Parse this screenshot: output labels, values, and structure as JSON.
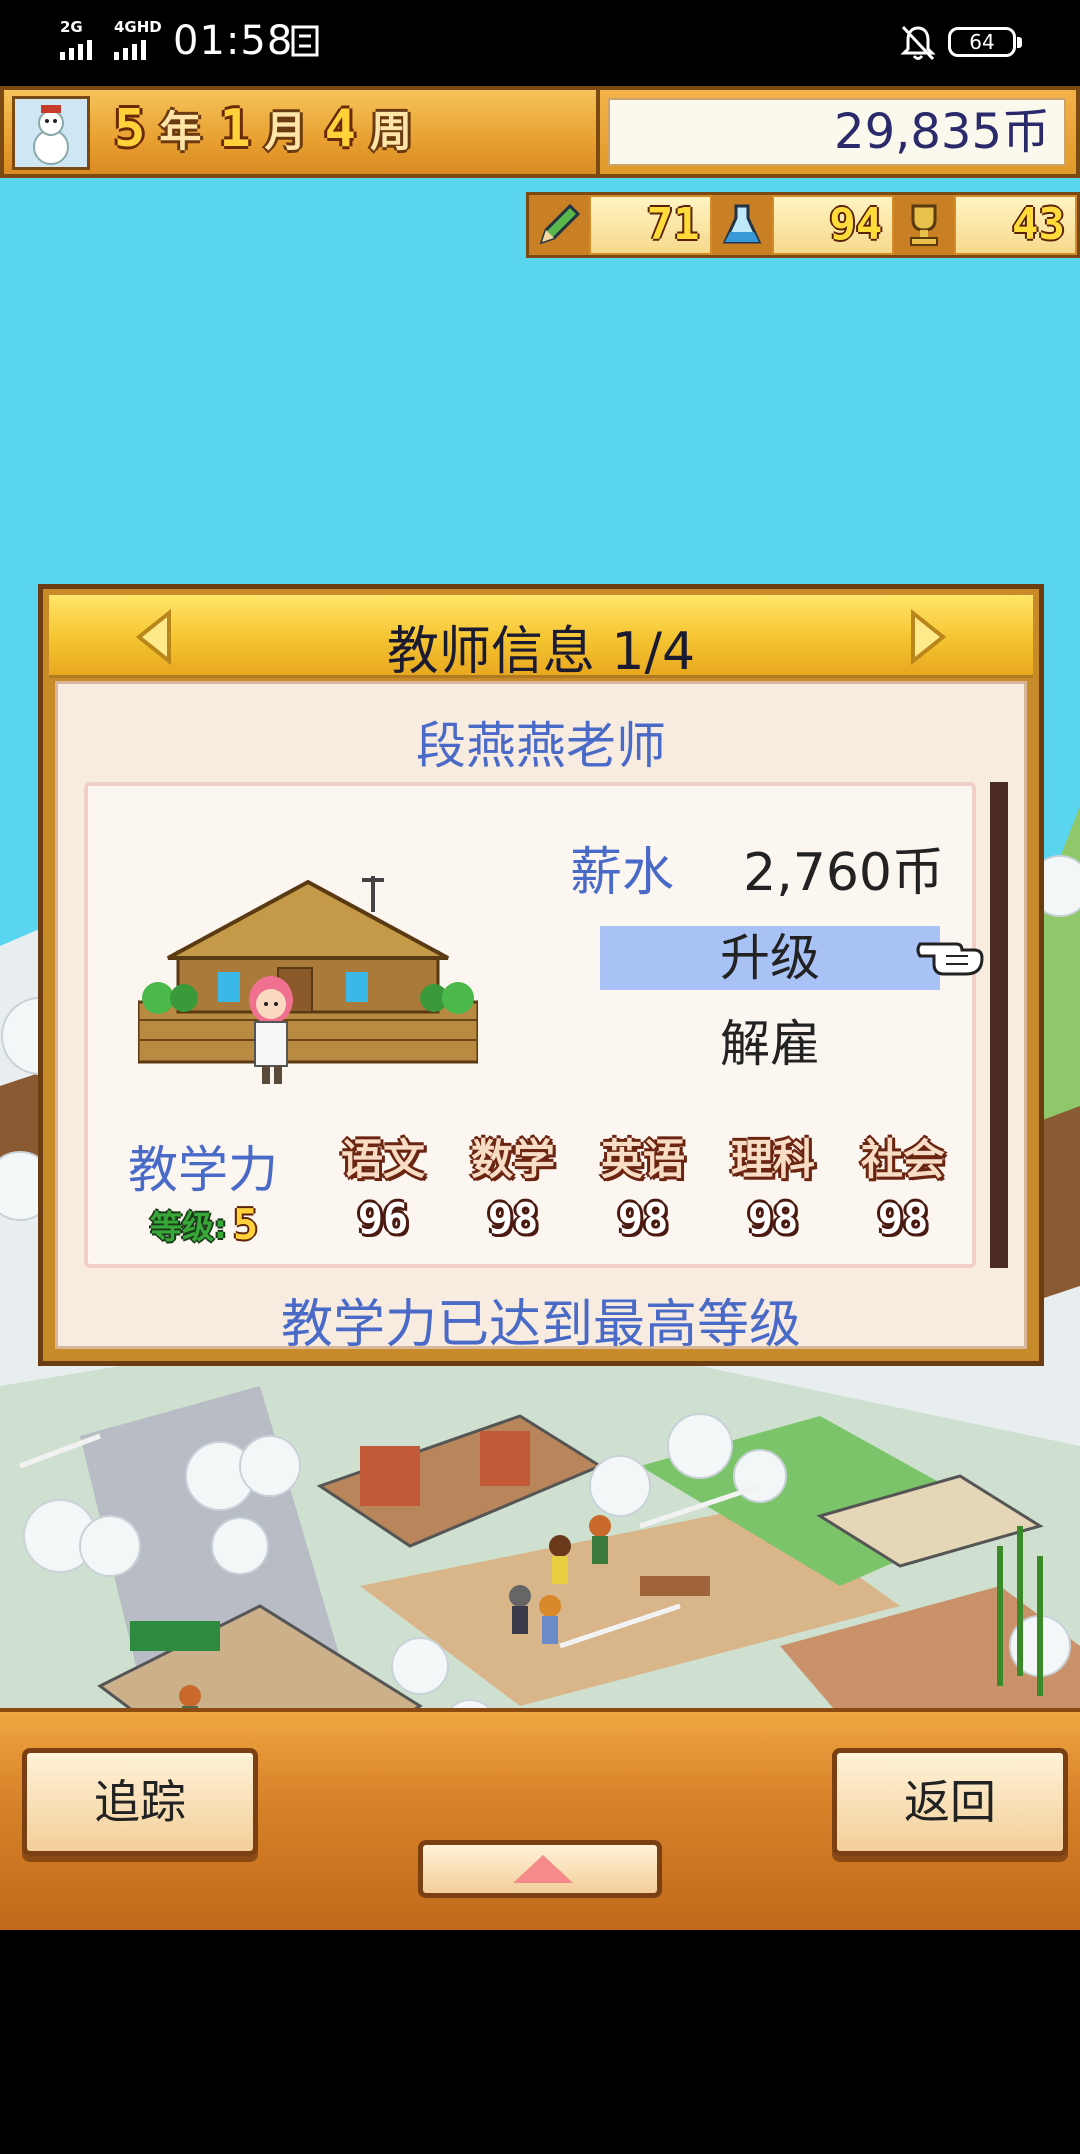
{
  "status_bar": {
    "network_1": "2G",
    "network_2": "4GHD",
    "time": "01:58",
    "battery": "64",
    "icons": [
      "signal-icon",
      "sync-icon",
      "mute-bell-icon",
      "battery-icon"
    ]
  },
  "hud": {
    "year": "5",
    "year_unit": "年",
    "month": "1",
    "month_unit": "月",
    "week": "4",
    "week_unit": "周",
    "money": "29,835币",
    "stats": [
      {
        "icon": "pencil-icon",
        "value": "71"
      },
      {
        "icon": "flask-icon",
        "value": "94"
      },
      {
        "icon": "trophy-icon",
        "value": "43"
      }
    ]
  },
  "dialog": {
    "title": "教师信息 1/4",
    "teacher_name": "段燕燕老师",
    "salary_label": "薪水",
    "salary_value": "2,760币",
    "upgrade_label": "升级",
    "fire_label": "解雇",
    "teaching_label": "教学力",
    "level_label": "等级:",
    "level_value": "5",
    "subjects": [
      {
        "name": "语文",
        "value": "96"
      },
      {
        "name": "数学",
        "value": "98"
      },
      {
        "name": "英语",
        "value": "98"
      },
      {
        "name": "理科",
        "value": "98"
      },
      {
        "name": "社会",
        "value": "98"
      }
    ],
    "note": "教学力已达到最高等级"
  },
  "bottom_bar": {
    "track_label": "追踪",
    "back_label": "返回"
  },
  "colors": {
    "sky": "#5ad5f0",
    "panel_orange": "#e8a030",
    "label_blue": "#4a6ac8",
    "highlight": "#a9c2f5"
  }
}
